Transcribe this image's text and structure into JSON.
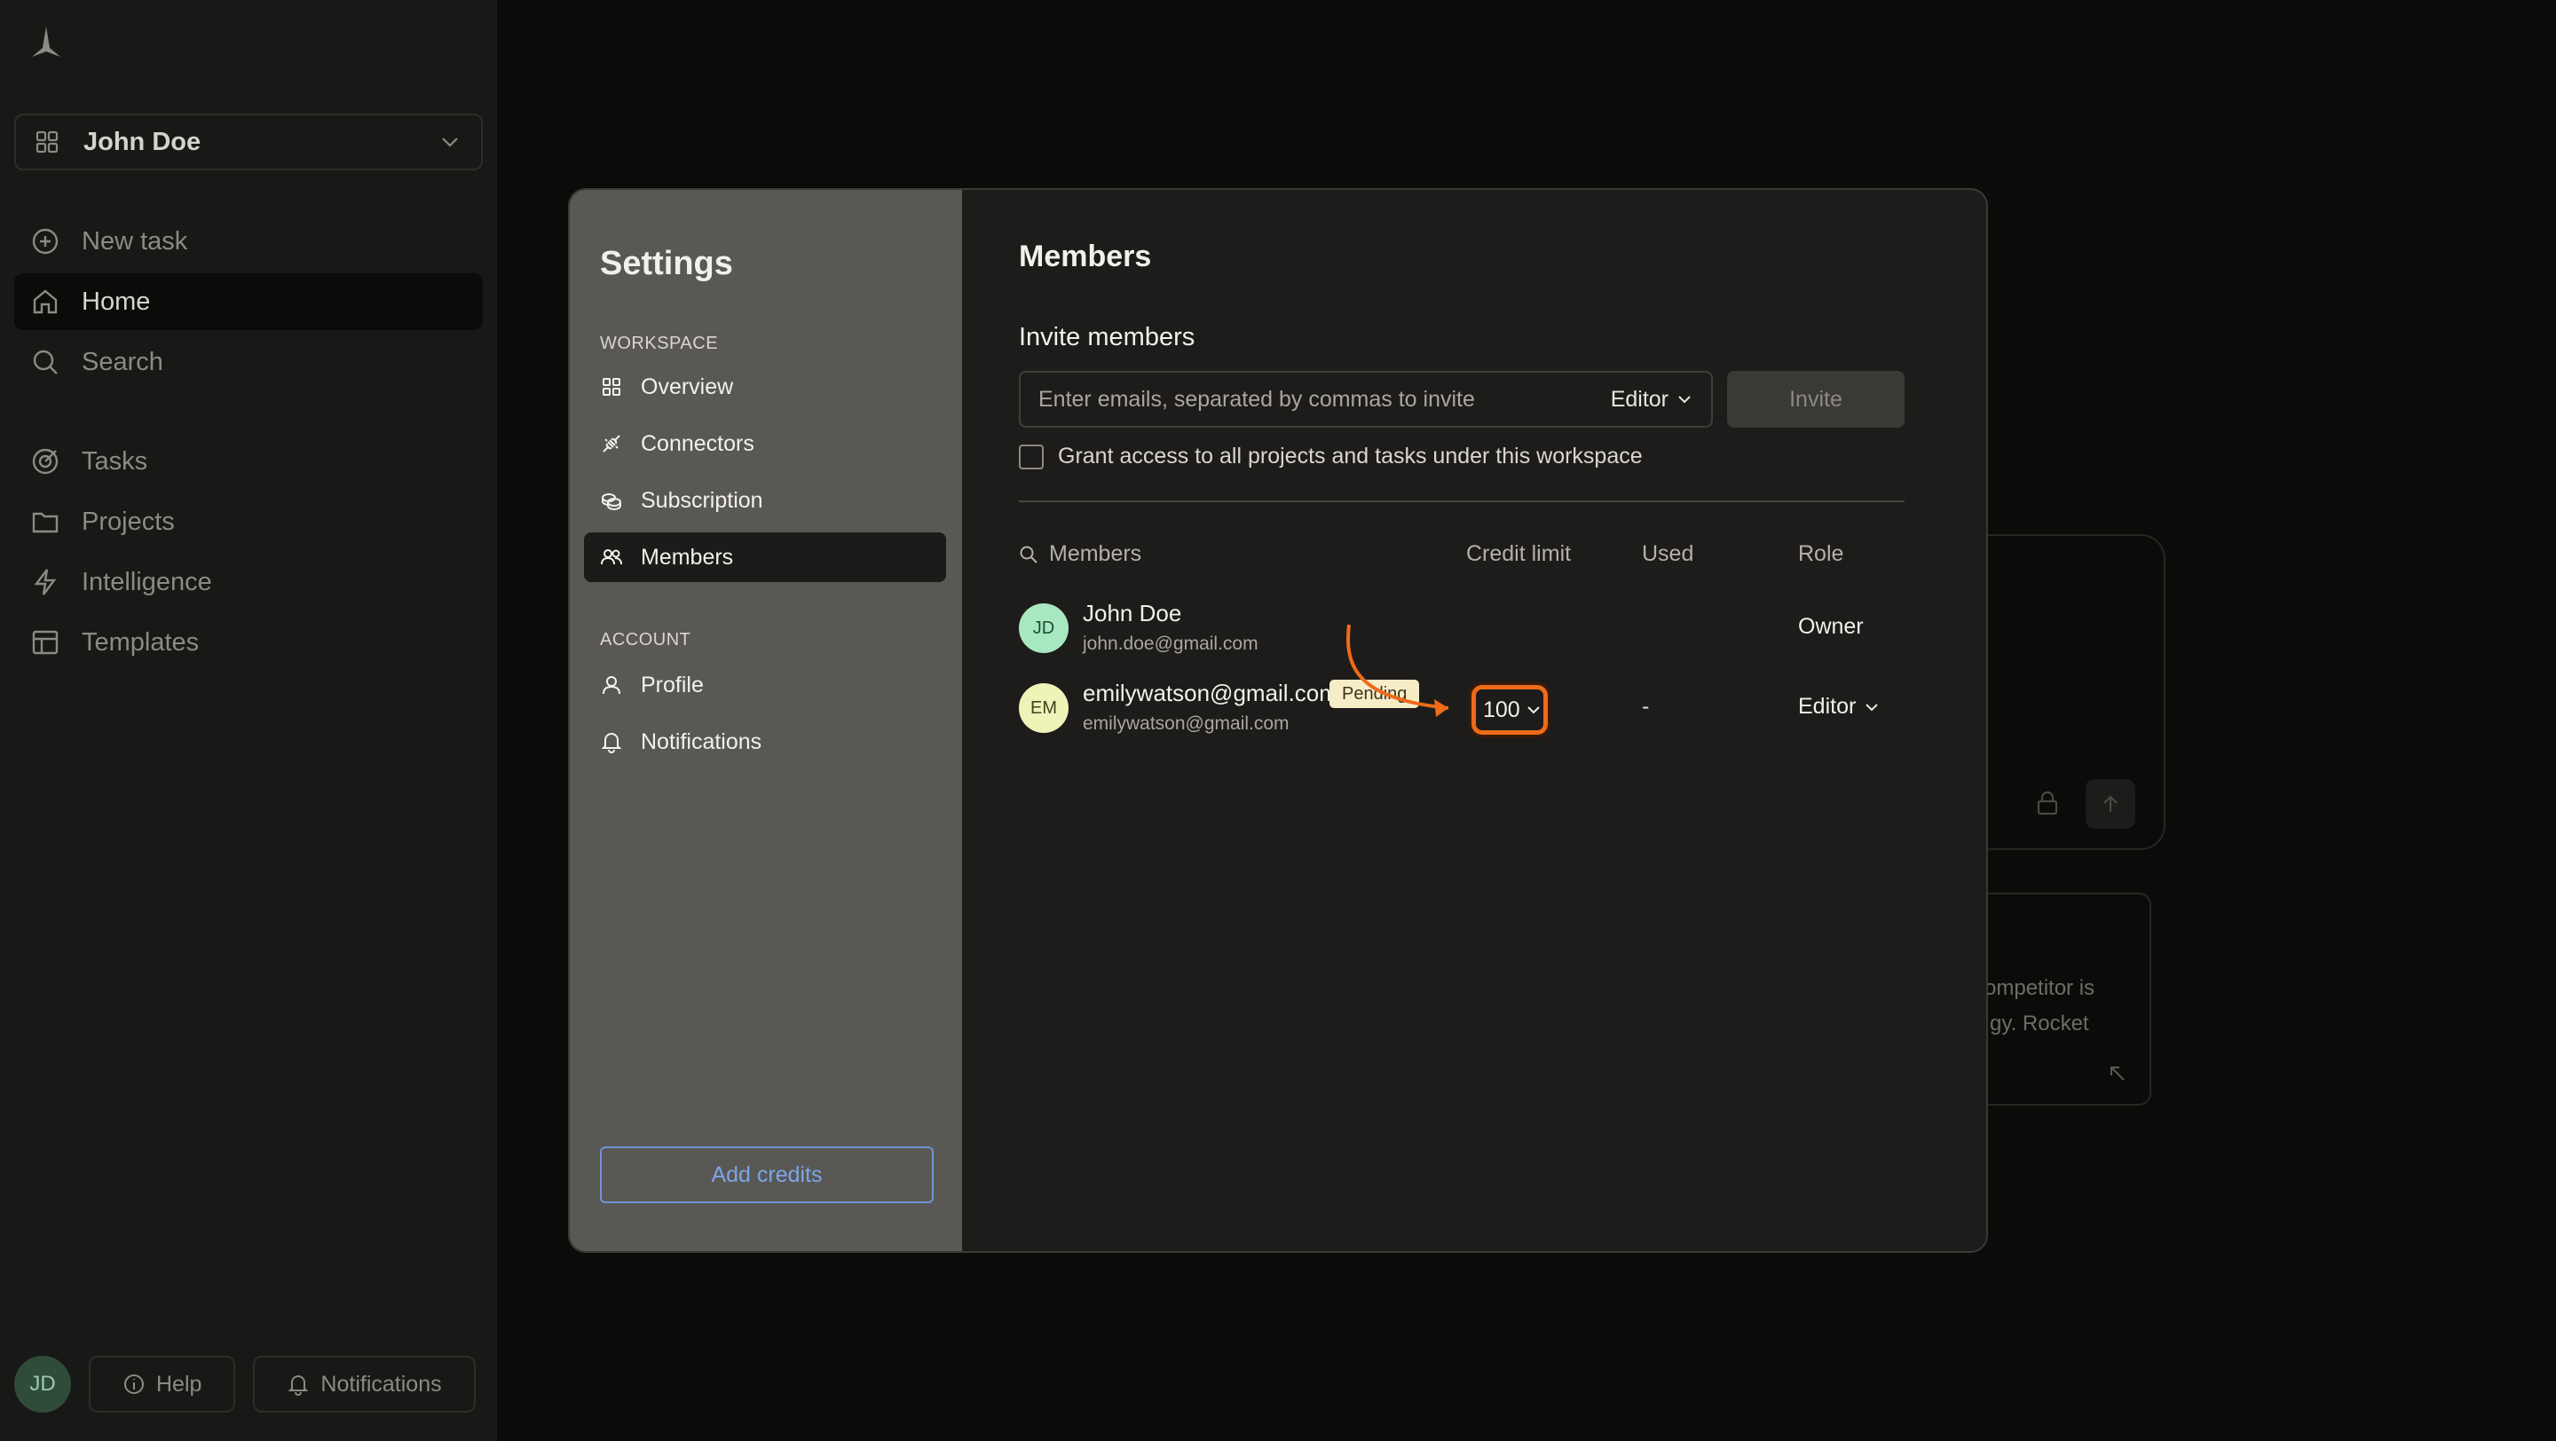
{
  "sidebar": {
    "workspace_name": "John Doe",
    "items": [
      {
        "label": "New task",
        "icon": "plus-circle-icon"
      },
      {
        "label": "Home",
        "icon": "home-icon"
      },
      {
        "label": "Search",
        "icon": "search-icon"
      },
      {
        "label": "Tasks",
        "icon": "target-icon"
      },
      {
        "label": "Projects",
        "icon": "folder-icon"
      },
      {
        "label": "Intelligence",
        "icon": "lightning-icon"
      },
      {
        "label": "Templates",
        "icon": "template-icon"
      }
    ],
    "avatar_initials": "JD",
    "help_label": "Help",
    "notifications_label": "Notifications"
  },
  "background": {
    "snippet_line1": "ompetitor is",
    "snippet_line2": "gy. Rocket"
  },
  "settings": {
    "title": "Settings",
    "workspace_section": "WORKSPACE",
    "workspace_items": [
      {
        "label": "Overview",
        "icon": "grid-icon"
      },
      {
        "label": "Connectors",
        "icon": "plug-icon"
      },
      {
        "label": "Subscription",
        "icon": "coins-icon"
      },
      {
        "label": "Members",
        "icon": "users-icon",
        "active": true
      }
    ],
    "account_section": "ACCOUNT",
    "account_items": [
      {
        "label": "Profile",
        "icon": "user-icon"
      },
      {
        "label": "Notifications",
        "icon": "bell-icon"
      }
    ],
    "add_credits_label": "Add credits"
  },
  "members_panel": {
    "title": "Members",
    "invite_title": "Invite members",
    "invite_placeholder": "Enter emails, separated by commas to invite",
    "invite_role": "Editor",
    "invite_button": "Invite",
    "grant_label": "Grant access to all projects and tasks under this workspace",
    "columns": {
      "members": "Members",
      "credit_limit": "Credit limit",
      "used": "Used",
      "role": "Role"
    },
    "members": [
      {
        "initials": "JD",
        "name": "John Doe",
        "email": "john.doe@gmail.com",
        "credit_limit": "",
        "used": "",
        "role": "Owner",
        "avatar_color": "#a8e8c0"
      },
      {
        "initials": "EM",
        "name": "emilywatson@gmail.com",
        "email": "emilywatson@gmail.com",
        "badge": "Pending",
        "credit_limit": "100",
        "used": "-",
        "role": "Editor",
        "avatar_color": "#eef3b8"
      }
    ]
  },
  "colors": {
    "accent_highlight": "#ef6a1a",
    "link_blue": "#7aa6e8",
    "badge_bg": "#f6ecc6"
  }
}
